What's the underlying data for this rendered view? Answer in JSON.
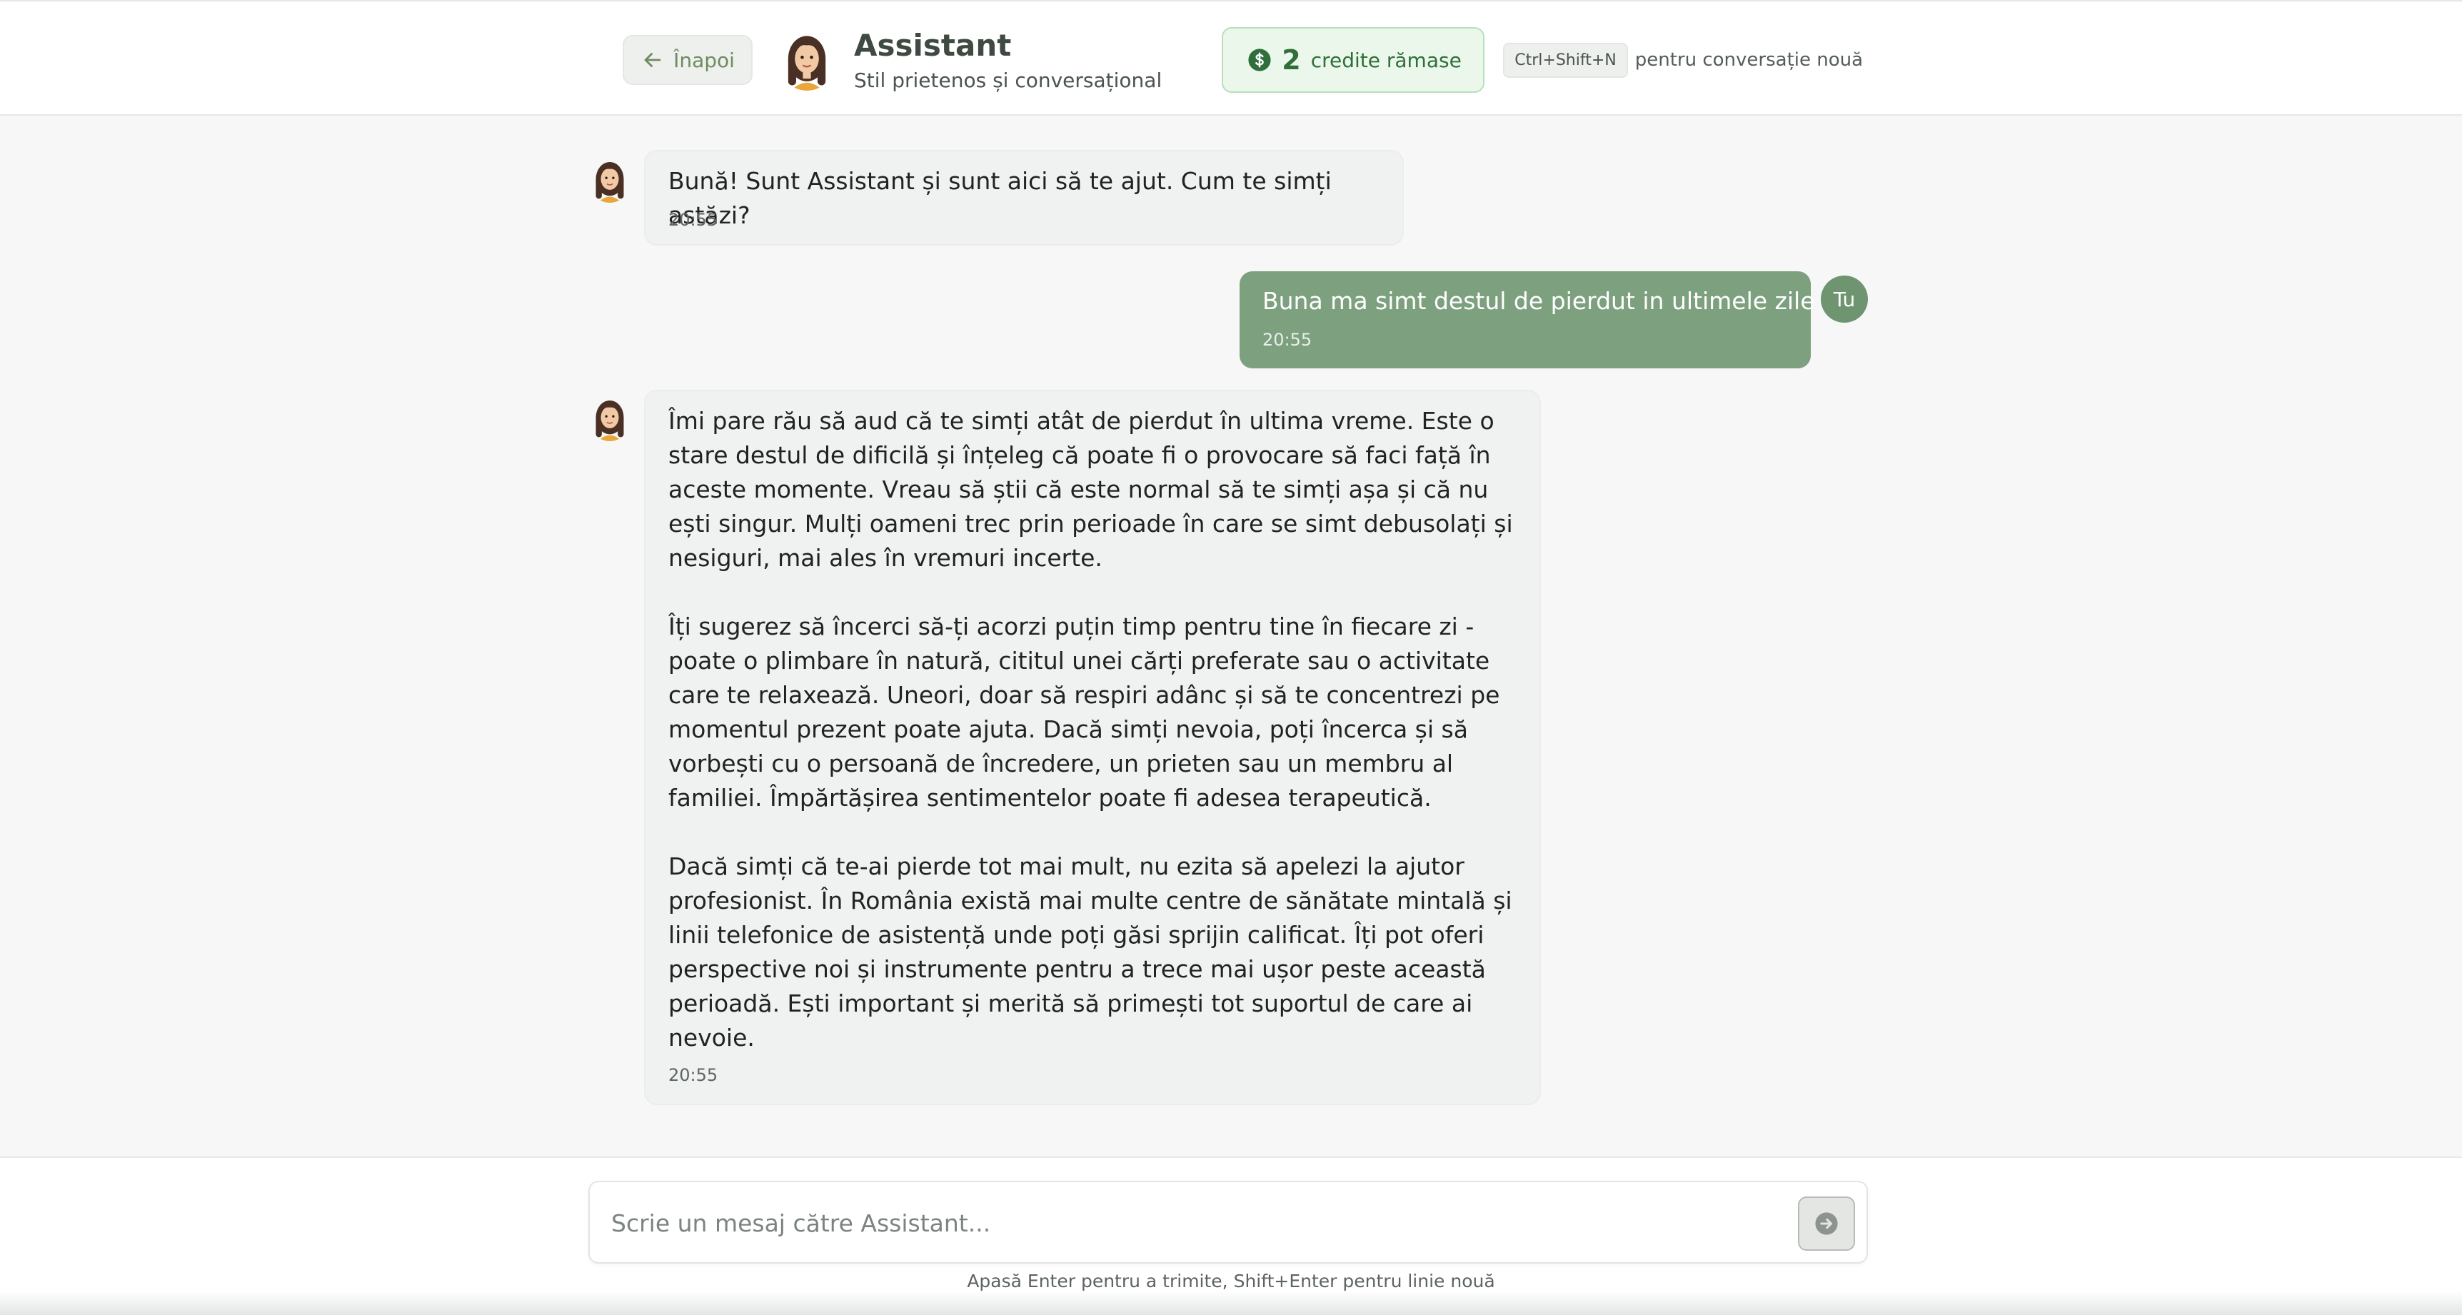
{
  "header": {
    "back_label": "Înapoi",
    "assistant_name": "Assistant",
    "assistant_style": "Stil prietenos și conversațional",
    "credits_count": "2",
    "credits_label": "credite rămase",
    "shortcut_key": "Ctrl+Shift+N",
    "shortcut_label": "pentru conversație nouă"
  },
  "messages": [
    {
      "role": "assistant",
      "text": "Bună! Sunt Assistant și sunt aici să te ajut. Cum te simți astăzi?",
      "time": "20:55"
    },
    {
      "role": "user",
      "avatar_label": "Tu",
      "text": "Buna ma simt destul de pierdut in ultimele zile",
      "time": "20:55"
    },
    {
      "role": "assistant",
      "paragraphs": [
        "Îmi pare rău să aud că te simți atât de pierdut în ultima vreme. Este o stare destul de dificilă și înțeleg că poate fi o provocare să faci față în aceste momente. Vreau să știi că este normal să te simți așa și că nu ești singur. Mulți oameni trec prin perioade în care se simt debusolați și nesiguri, mai ales în vremuri incerte.",
        "Îți sugerez să încerci să-ți acorzi puțin timp pentru tine în fiecare zi - poate o plimbare în natură, cititul unei cărți preferate sau o activitate care te relaxează. Uneori, doar să respiri adânc și să te concentrezi pe momentul prezent poate ajuta. Dacă simți nevoia, poți încerca și să vorbești cu o persoană de încredere, un prieten sau un membru al familiei. Împărtășirea sentimentelor poate fi adesea terapeutică.",
        "Dacă simți că te-ai pierde tot mai mult, nu ezita să apelezi la ajutor profesionist. În România există mai multe centre de sănătate mintală și linii telefonice de asistență unde poți găsi sprijin calificat. Îți pot oferi perspective noi și instrumente pentru a trece mai ușor peste această perioadă. Ești important și merită să primești tot suportul de care ai nevoie."
      ],
      "time": "20:55"
    }
  ],
  "composer": {
    "placeholder": "Scrie un mesaj către Assistant...",
    "value": "",
    "hint": "Apasă Enter pentru a trimite, Shift+Enter pentru linie nouă"
  },
  "colors": {
    "accent_green": "#7da07f",
    "credits_bg": "#eaf7ea",
    "credits_text": "#2f6f3a",
    "back_text": "#6f8c5f"
  },
  "icons": {
    "back": "arrow-left-icon",
    "credits": "dollar-coin-icon",
    "send": "arrow-right-circle-icon",
    "assistant_avatar": "woman-avatar-icon"
  }
}
